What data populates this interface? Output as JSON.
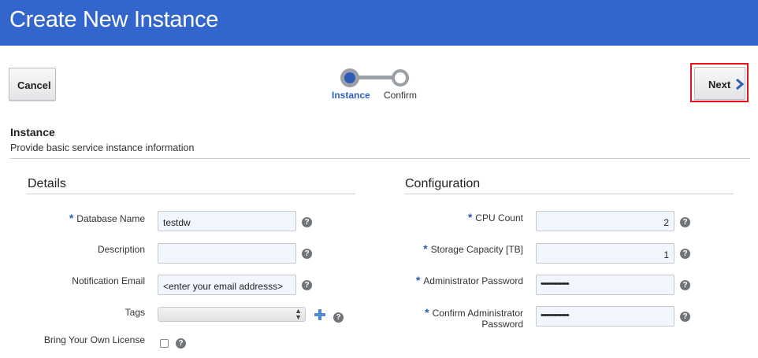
{
  "header": {
    "title": "Create New Instance"
  },
  "toolbar": {
    "cancel_label": "Cancel",
    "next_label": "Next"
  },
  "train": {
    "steps": [
      "Instance",
      "Confirm"
    ],
    "current": "Instance"
  },
  "section": {
    "title": "Instance",
    "description": "Provide basic service instance information"
  },
  "details": {
    "title": "Details",
    "database_name": {
      "label": "Database Name",
      "value": "testdw",
      "required": true
    },
    "description": {
      "label": "Description",
      "value": ""
    },
    "notification_email": {
      "label": "Notification Email",
      "placeholder": "<enter your email addresss>"
    },
    "tags": {
      "label": "Tags",
      "value": ""
    },
    "byol": {
      "label": "Bring Your Own License",
      "checked": false
    }
  },
  "configuration": {
    "title": "Configuration",
    "cpu_count": {
      "label": "CPU Count",
      "value": "2",
      "required": true
    },
    "storage_capacity": {
      "label": "Storage Capacity [TB]",
      "value": "1",
      "required": true
    },
    "admin_password": {
      "label": "Administrator Password",
      "masked": "•••••••••••••••",
      "required": true
    },
    "confirm_password": {
      "label_line1": "Confirm Administrator",
      "label_line2": "Password",
      "masked": "•••••••••••••••",
      "required": true
    }
  },
  "icons": {
    "help": "?",
    "help_color": "#707478",
    "accent": "#3366cc",
    "required_mark": "*"
  }
}
